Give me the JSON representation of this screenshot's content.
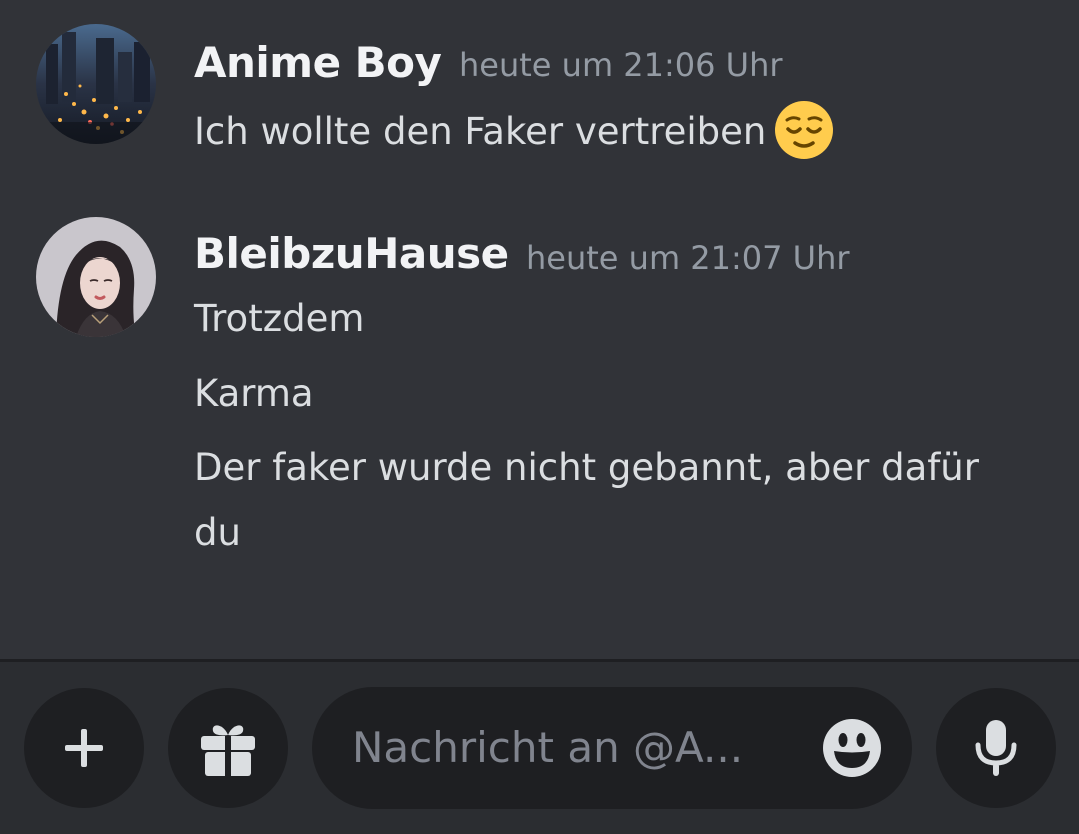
{
  "messages": [
    {
      "username": "Anime Boy",
      "timestamp": "heute um 21:06 Uhr",
      "lines": [
        "Ich wollte den Faker vertreiben"
      ],
      "emoji": "relieved-face-icon"
    },
    {
      "username": "BleibzuHause",
      "timestamp": "heute um 21:07 Uhr",
      "lines": [
        "Trotzdem",
        "Karma",
        "Der faker wurde nicht gebannt, aber dafür",
        "du"
      ]
    }
  ],
  "composer": {
    "placeholder": "Nachricht an @A..."
  },
  "colors": {
    "background": "#313338",
    "composer_bar": "#2b2d31",
    "button_bg": "#1e1f22",
    "username": "#f2f3f5",
    "timestamp": "#949ba4",
    "message_text": "#dbdee1",
    "emoji_yellow": "#ffcc4d"
  },
  "icons": [
    "plus-icon",
    "gift-icon",
    "emoji-picker-icon",
    "microphone-icon"
  ]
}
